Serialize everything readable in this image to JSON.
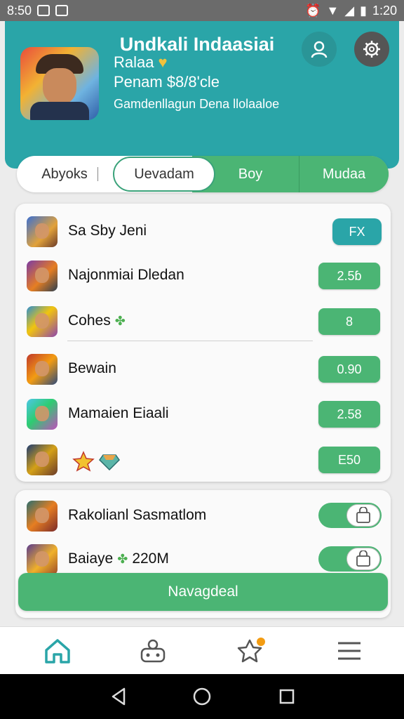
{
  "status_bar": {
    "time_left": "8:50",
    "time_right": "1:20"
  },
  "header": {
    "title": "Undkali Indaasiai",
    "profile": {
      "name": "Ralaa",
      "balance": "Penam $8/8'cle",
      "subtitle": "Gamdenllagun Dena llolaaloe"
    }
  },
  "tabs": [
    {
      "label": "Abyoks"
    },
    {
      "label": "Uevadam"
    },
    {
      "label": "Boy"
    },
    {
      "label": "Mudaa"
    }
  ],
  "list": [
    {
      "label": "Sa Sby Jeni",
      "value": "FX"
    },
    {
      "label": "Najonmiai Dledan",
      "value": "2.5ɓ"
    },
    {
      "label": "Cohes",
      "value": "8"
    },
    {
      "label": "Bewain",
      "value": "0.90"
    },
    {
      "label": "Mamaien Eiaali",
      "value": "2.58"
    },
    {
      "label": "",
      "value": "E50"
    }
  ],
  "settings": [
    {
      "label": "Rakolianl Sasmatlom"
    },
    {
      "label": "Baiaye",
      "extra": "220M"
    }
  ],
  "primary_button": {
    "label": "Navagdeal"
  },
  "colors": {
    "teal": "#2aa5a8",
    "green": "#4bb574",
    "badge_orange": "#f39c12"
  },
  "icons": {
    "header": [
      "user-icon",
      "gear-icon"
    ],
    "bottom_nav": [
      "home-icon",
      "controller-icon",
      "star-badge-icon",
      "menu-icon"
    ],
    "system_nav": [
      "back-icon",
      "home-circle-icon",
      "recents-icon"
    ]
  }
}
